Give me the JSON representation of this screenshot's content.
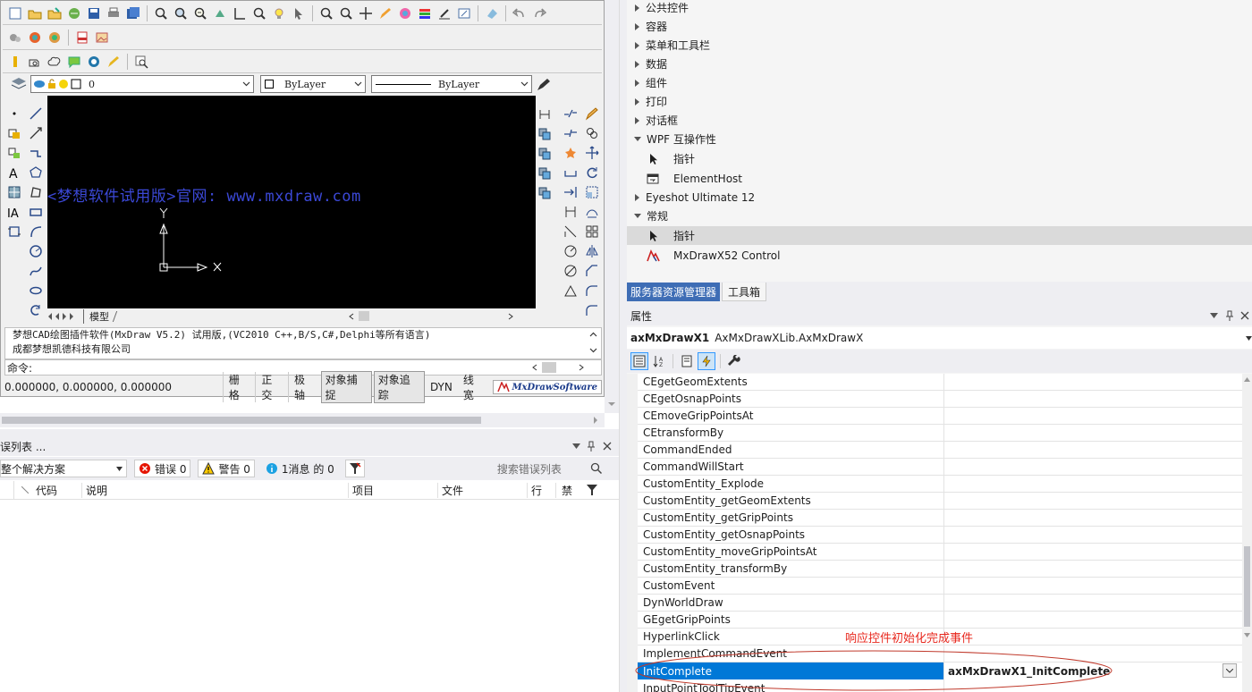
{
  "cad": {
    "layer_combo": "0",
    "color_combo": "ByLayer",
    "linetype_combo": "ByLayer",
    "watermark": "<梦想软件试用版>官网: www.mxdraw.com",
    "axis_y": "Y",
    "axis_x": "X",
    "tab_model": "模型",
    "command_lines": [
      "梦想CAD绘图插件软件(MxDraw V5.2) 试用版,(VC2010 C++,B/S,C#,Delphi等所有语言)",
      "成都梦想凯德科技有限公司"
    ],
    "command_prompt": "命令:",
    "coords": "0.000000,  0.000000,  0.000000",
    "status_buttons": [
      "栅格",
      "正交",
      "极轴",
      "对象捕捉",
      "对象追踪",
      "DYN",
      "线宽"
    ],
    "brand": "MxDrawSoftware"
  },
  "error_list": {
    "title": "误列表 ...",
    "scope": "整个解决方案",
    "errors": "错误 0",
    "warnings": "警告 0",
    "messages": "1消息 的 0",
    "search_placeholder": "搜索错误列表",
    "columns": [
      "代码",
      "说明",
      "项目",
      "文件",
      "行",
      "禁"
    ]
  },
  "toolbox": {
    "groups": [
      {
        "label": "公共控件",
        "expanded": false
      },
      {
        "label": "容器",
        "expanded": false
      },
      {
        "label": "菜单和工具栏",
        "expanded": false
      },
      {
        "label": "数据",
        "expanded": false
      },
      {
        "label": "组件",
        "expanded": false
      },
      {
        "label": "打印",
        "expanded": false
      },
      {
        "label": "对话框",
        "expanded": false
      },
      {
        "label": "WPF 互操作性",
        "expanded": true
      },
      {
        "label": "指针",
        "item": true
      },
      {
        "label": "ElementHost",
        "item": true
      },
      {
        "label": "Eyeshot Ultimate 12",
        "expanded": false
      },
      {
        "label": "常规",
        "expanded": true
      },
      {
        "label": "指针",
        "item": true,
        "selected": true
      },
      {
        "label": "MxDrawX52 Control",
        "item": true
      }
    ]
  },
  "tabs": [
    "服务器资源管理器",
    "工具箱"
  ],
  "properties": {
    "title": "属性",
    "object_name": "axMxDrawX1",
    "object_type": "AxMxDrawXLib.AxMxDrawX",
    "rows": [
      "CEgetGeomExtents",
      "CEgetOsnapPoints",
      "CEmoveGripPointsAt",
      "CEtransformBy",
      "CommandEnded",
      "CommandWillStart",
      "CustomEntity_Explode",
      "CustomEntity_getGeomExtents",
      "CustomEntity_getGripPoints",
      "CustomEntity_getOsnapPoints",
      "CustomEntity_moveGripPointsAt",
      "CustomEntity_transformBy",
      "CustomEvent",
      "DynWorldDraw",
      "GEgetGripPoints",
      "HyperlinkClick",
      "ImplementCommandEvent",
      "InitComplete",
      "InputPointToolTipEvent"
    ],
    "selected_row": "InitComplete",
    "selected_value": "axMxDrawX1_InitComplete",
    "annotation": "响应控件初始化完成事件",
    "accent_color": "#0078d7",
    "annotation_color": "#e8281e"
  }
}
